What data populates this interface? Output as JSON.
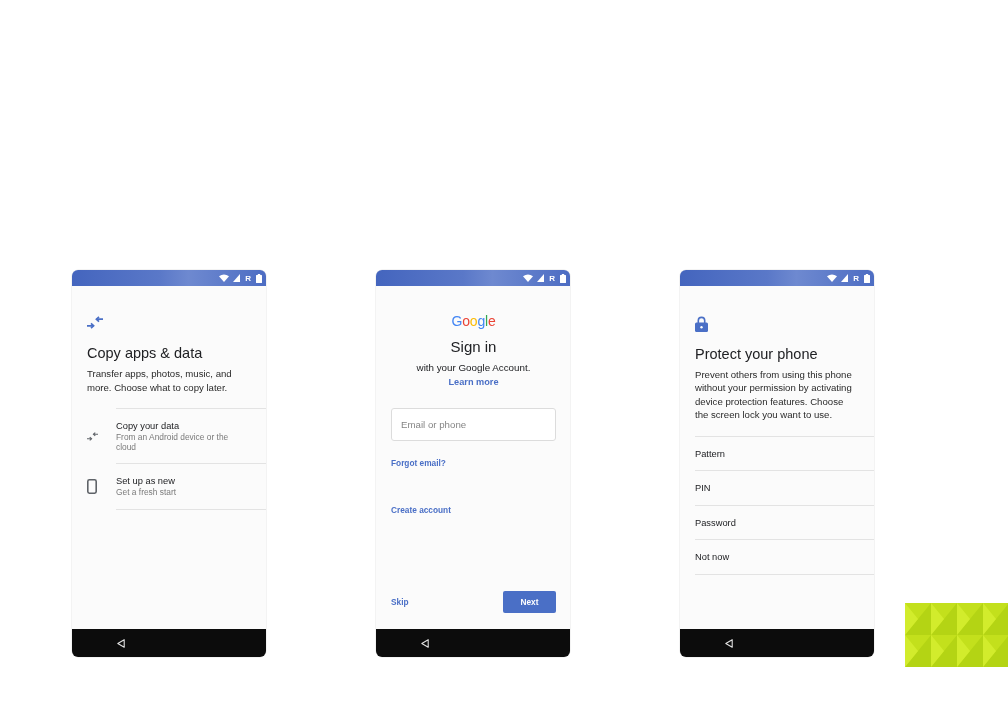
{
  "phones": [
    {
      "kind": "copy_data",
      "status_bar": {
        "network_label": "R"
      },
      "title": "Copy apps & data",
      "description": "Transfer apps, photos, music, and more. Choose what to copy later.",
      "options": [
        {
          "kind": "copy",
          "title": "Copy your data",
          "subtitle": "From an Android device or the cloud"
        },
        {
          "kind": "new",
          "title": "Set up as new",
          "subtitle": "Get a fresh start"
        }
      ]
    },
    {
      "kind": "sign_in",
      "status_bar": {
        "network_label": "R"
      },
      "logo": "Google",
      "title": "Sign in",
      "subtitle": "with your Google Account.",
      "learn_more_link": "Learn more",
      "email_field": {
        "placeholder": "Email or phone"
      },
      "forgot_email_link": "Forgot email?",
      "create_account_link": "Create account",
      "skip_button": "Skip",
      "next_button": "Next"
    },
    {
      "kind": "screen_lock",
      "status_bar": {
        "network_label": "R"
      },
      "title": "Protect your phone",
      "description": "Prevent others from using this phone without your permission by activating device protection features. Choose the screen lock you want to use.",
      "options": [
        "Pattern",
        "PIN",
        "Password",
        "Not now"
      ]
    }
  ]
}
